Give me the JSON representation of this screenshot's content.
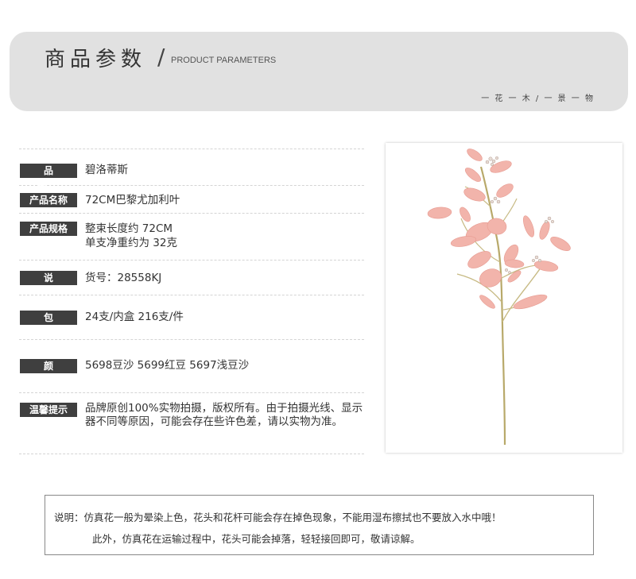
{
  "header": {
    "title": "商品参数",
    "slash": "/",
    "subtitle": "PRODUCT PARAMETERS",
    "motto": "一 花 一 木 / 一 景 一 物"
  },
  "specs": {
    "brand": {
      "label": "品 牌",
      "value": "碧洛蒂斯"
    },
    "name": {
      "label": "产品名称",
      "value": "72CM巴黎尤加利叶"
    },
    "size": {
      "label": "产品规格",
      "value_line1": "整束长度约 72CM",
      "value_line2": "单支净重约为 32克"
    },
    "note": {
      "label": "说 明",
      "value": "货号：28558KJ"
    },
    "packing": {
      "label": "包 装",
      "value": "24支/内盒  216支/件"
    },
    "color": {
      "label": "颜 色",
      "value": "5698豆沙  5699红豆  5697浅豆沙"
    },
    "tip": {
      "label": "温馨提示",
      "value": "品牌原创100%实物拍摄，版权所有。由于拍摄光线、显示器不同等原因，可能会存在些许色差，请以实物为准。"
    }
  },
  "notice": {
    "line1": "说明：仿真花一般为晕染上色，花头和花杆可能会存在掉色现象，不能用湿布擦拭也不要放入水中哦！",
    "line2": "此外，仿真花在运输过程中，花头可能会掉落，轻轻接回即可，敬请谅解。"
  },
  "colors": {
    "banner_bg": "#e1e1e1",
    "label_bg": "#3f3f3f",
    "leaf_pink": "#f2b4ab",
    "stem": "#b8a96a"
  },
  "icons": {
    "product_photo": "eucalyptus-stem-image"
  }
}
